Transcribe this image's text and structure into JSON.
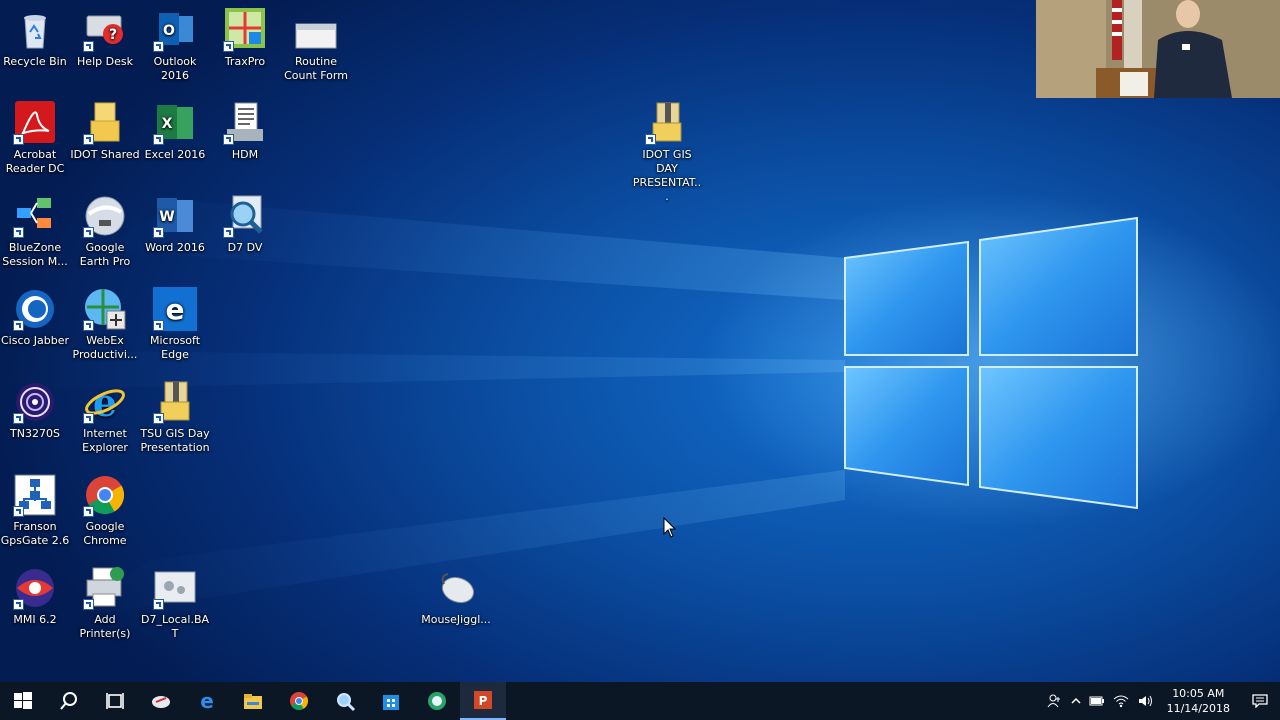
{
  "desktop": {
    "icons": [
      {
        "label": "Recycle Bin",
        "icon": "recycle-bin-icon"
      },
      {
        "label": "Help Desk",
        "icon": "help-desk-icon"
      },
      {
        "label": "Outlook 2016",
        "icon": "outlook-icon"
      },
      {
        "label": "TraxPro",
        "icon": "traxpro-icon"
      },
      {
        "label": "Routine Count Form",
        "icon": "form-icon"
      },
      {
        "label": "Acrobat Reader DC",
        "icon": "acrobat-icon"
      },
      {
        "label": "IDOT Shared",
        "icon": "folder-icon"
      },
      {
        "label": "Excel 2016",
        "icon": "excel-icon"
      },
      {
        "label": "HDM",
        "icon": "document-icon"
      },
      {
        "label": "IDOT GIS DAY PRESENTAT...",
        "icon": "zip-folder-icon"
      },
      {
        "label": "BlueZone Session M...",
        "icon": "bluezone-icon"
      },
      {
        "label": "Google Earth Pro",
        "icon": "google-earth-icon"
      },
      {
        "label": "Word 2016",
        "icon": "word-icon"
      },
      {
        "label": "D7 DV",
        "icon": "magnifier-icon"
      },
      {
        "label": "Cisco Jabber",
        "icon": "cisco-jabber-icon"
      },
      {
        "label": "WebEx Productivi...",
        "icon": "webex-icon"
      },
      {
        "label": "Microsoft Edge",
        "icon": "edge-icon"
      },
      {
        "label": "TN3270S",
        "icon": "tn3270-icon"
      },
      {
        "label": "Internet Explorer",
        "icon": "internet-explorer-icon"
      },
      {
        "label": "TSU GIS Day Presentation",
        "icon": "zip-folder-icon"
      },
      {
        "label": "Franson GpsGate 2.6",
        "icon": "gpsgate-icon"
      },
      {
        "label": "Google Chrome",
        "icon": "chrome-icon"
      },
      {
        "label": "MMI 6.2",
        "icon": "mmi-icon"
      },
      {
        "label": "Add Printer(s)",
        "icon": "printer-icon"
      },
      {
        "label": "D7_Local.BAT",
        "icon": "batch-file-icon"
      },
      {
        "label": "MouseJiggl...",
        "icon": "mouse-icon"
      }
    ]
  },
  "taskbar": {
    "pinned": [
      "start-icon",
      "search-icon",
      "task-view-icon",
      "snipping-tool-icon",
      "edge-icon",
      "file-explorer-icon",
      "chrome-icon",
      "magnifier-icon",
      "store-icon",
      "app-icon",
      "powerpoint-icon"
    ],
    "tray_icons": [
      "people-icon",
      "chevron-up-icon",
      "battery-icon",
      "network-icon",
      "volume-icon"
    ],
    "time": "10:05 AM",
    "date": "11/14/2018",
    "notification_icon": "action-center-icon"
  },
  "colors": {
    "taskbar": "#0c1726",
    "accent": "#1e7ae0"
  }
}
